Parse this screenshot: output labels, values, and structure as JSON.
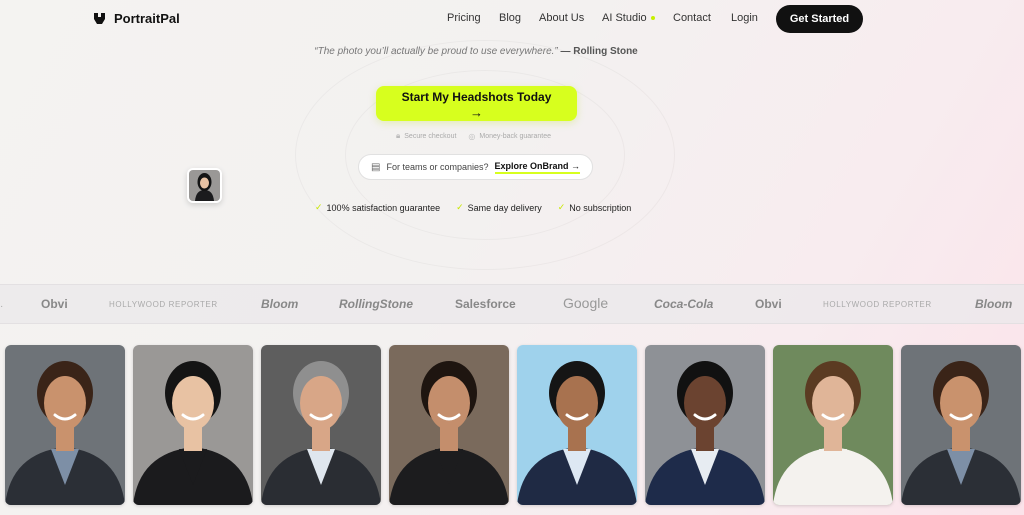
{
  "brand": {
    "name": "PortraitPal"
  },
  "nav": {
    "links": [
      "Pricing",
      "Blog",
      "About Us",
      "AI Studio",
      "Contact",
      "Login"
    ],
    "cta": "Get Started"
  },
  "hero": {
    "quote": "“The photo you’ll actually be proud to use everywhere.”",
    "quote_source": "— Rolling Stone",
    "cta_label": "Start My Headshots Today",
    "cta_arrow": "→",
    "assurances": [
      "Secure checkout",
      "Money-back guarantee"
    ],
    "teams_text": "For teams or companies?",
    "teams_link": "Explore OnBrand →",
    "checks": [
      "100% satisfaction guarantee",
      "Same day delivery",
      "No subscription"
    ]
  },
  "logos": [
    "Obvi",
    "HOLLYWOOD REPORTER",
    "Bloom",
    "RollingStone",
    "Salesforce",
    "Google",
    "Coca-Cola",
    "Obvi",
    "HOLLYWOOD REPORTER",
    "Bloom"
  ],
  "photos": [
    {
      "bg": "#6e7378",
      "skin": "#c9926d",
      "hair": "#3a2418",
      "suit": "#2b2f36",
      "shirt": "#7d8fa6"
    },
    {
      "bg": "#9a9896",
      "skin": "#e8c2a3",
      "hair": "#141414",
      "suit": "#1b1b1d",
      "shirt": "#1b1b1d"
    },
    {
      "bg": "#5e5e5e",
      "skin": "#d8a687",
      "hair": "#8f8f8f",
      "suit": "#2a2d33",
      "shirt": "#dfe6ee"
    },
    {
      "bg": "#7a6a5c",
      "skin": "#c48e6c",
      "hair": "#1e1510",
      "suit": "#1c1c1e",
      "shirt": "#1c1c1e"
    },
    {
      "bg": "#9fd2ec",
      "skin": "#a8724f",
      "hair": "#151515",
      "suit": "#1f2a44",
      "shirt": "#dde8f3"
    },
    {
      "bg": "#8e9196",
      "skin": "#6b4330",
      "hair": "#111111",
      "suit": "#1e2b4a",
      "shirt": "#e7ecf2"
    },
    {
      "bg": "#6f8a5d",
      "skin": "#e0b598",
      "hair": "#5b3b22",
      "suit": "#f4f2ee",
      "shirt": "#f4f2ee"
    },
    {
      "bg": "#6e7378",
      "skin": "#c9926d",
      "hair": "#3a2418",
      "suit": "#2b2f36",
      "shirt": "#7d8fa6"
    }
  ],
  "colors": {
    "accent": "#d7ff1e",
    "dark": "#111111"
  }
}
